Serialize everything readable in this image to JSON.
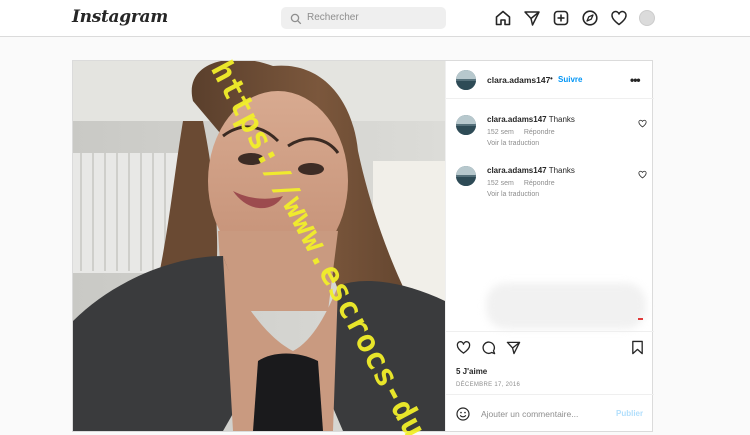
{
  "header": {
    "logo": "Instagram",
    "search_placeholder": "Rechercher",
    "nav_icons": [
      "home-icon",
      "direct-icon",
      "new-post-icon",
      "explore-icon",
      "activity-heart-icon",
      "profile-avatar"
    ]
  },
  "post": {
    "username": "clara.adams147",
    "follow_label": "Suivre",
    "separator": "•",
    "more_label": "•••",
    "comments": [
      {
        "username": "clara.adams147",
        "text": "Thanks",
        "age": "152 sem",
        "reply_label": "Répondre",
        "translate_label": "Voir la traduction"
      },
      {
        "username": "clara.adams147",
        "text": "Thanks",
        "age": "152 sem",
        "reply_label": "Répondre",
        "translate_label": "Voir la traduction"
      }
    ],
    "likes": "5 J'aime",
    "date": "DÉCEMBRE 17, 2016",
    "add_comment_placeholder": "Ajouter un commentaire...",
    "publish_label": "Publier"
  },
  "watermark": "https://www.escrocs-du-web.fr",
  "colors": {
    "accent": "#0095f6",
    "publish_disabled": "#b2dffc",
    "watermark": "#f2ef2a"
  }
}
